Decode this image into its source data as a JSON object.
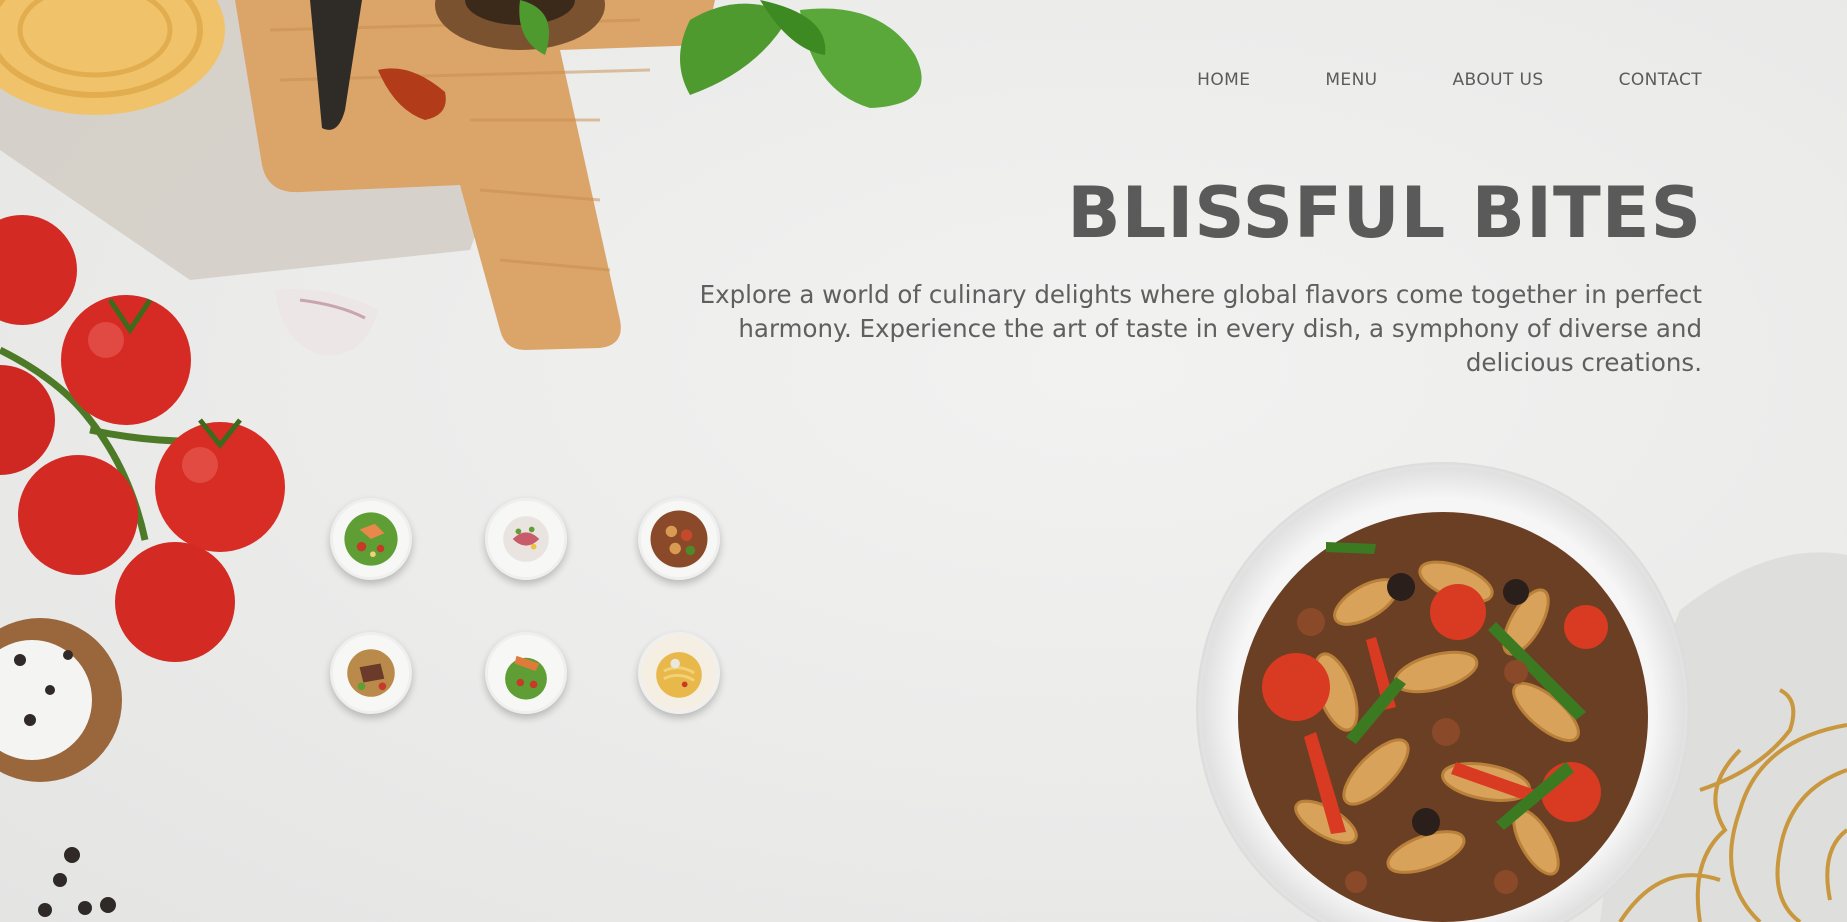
{
  "nav": {
    "items": [
      {
        "label": "HOME"
      },
      {
        "label": "MENU"
      },
      {
        "label": "ABOUT US"
      },
      {
        "label": "CONTACT"
      }
    ]
  },
  "hero": {
    "title": "BLISSFUL BITES",
    "description": "Explore a world of culinary delights where global flavors come together in perfect harmony. Experience the art of taste in every dish, a symphony of diverse and delicious creations."
  },
  "dishes": {
    "thumbnails": [
      {
        "icon": "salad-with-salmon-icon"
      },
      {
        "icon": "tuna-salad-icon"
      },
      {
        "icon": "fusilli-pasta-icon"
      },
      {
        "icon": "steak-plate-icon"
      },
      {
        "icon": "grilled-salmon-salad-icon"
      },
      {
        "icon": "noodle-dish-icon"
      }
    ],
    "featured": {
      "icon": "fusilli-pasta-bowl-icon"
    }
  },
  "colors": {
    "background": "#ebebea",
    "text": "#5a5a5a",
    "tomato": "#d42a24",
    "wood": "#d9a56b",
    "basil": "#4f9a2f",
    "gold_ornament": "#c8973e"
  }
}
